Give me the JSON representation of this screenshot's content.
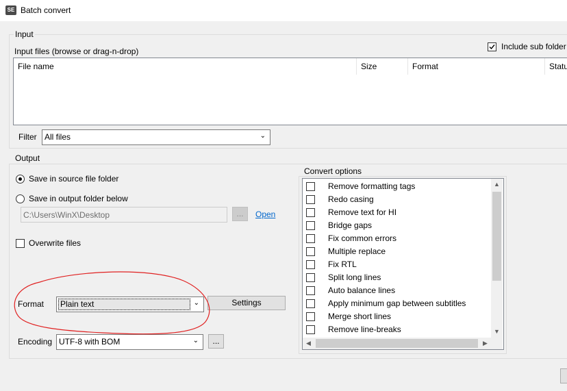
{
  "window": {
    "title": "Batch convert",
    "icon_text": "SE"
  },
  "input": {
    "legend": "Input",
    "files_label": "Input files (browse or drag-n-drop)",
    "include_sub": "Include sub folder",
    "include_sub_checked": true,
    "columns": [
      "File name",
      "Size",
      "Format",
      "Statu"
    ]
  },
  "filter": {
    "label": "Filter",
    "value": "All files"
  },
  "output": {
    "legend": "Output",
    "save_source": "Save in source file folder",
    "save_output": "Save in output folder below",
    "selected": "save_source",
    "folder_path": "C:\\Users\\WinX\\Desktop",
    "browse_label": "...",
    "open_label": "Open",
    "overwrite": "Overwrite files",
    "overwrite_checked": false
  },
  "format": {
    "label": "Format",
    "value": "Plain text",
    "settings_label": "Settings"
  },
  "encoding": {
    "label": "Encoding",
    "value": "UTF-8 with BOM",
    "more_label": "..."
  },
  "convert": {
    "legend": "Convert options",
    "options": [
      "Remove formatting tags",
      "Redo casing",
      "Remove text for HI",
      "Bridge gaps",
      "Fix common errors",
      "Multiple replace",
      "Fix RTL",
      "Split long lines",
      "Auto balance lines",
      "Apply minimum gap between subtitles",
      "Merge short lines",
      "Remove line-breaks"
    ]
  },
  "annotation_color": "#e02020"
}
